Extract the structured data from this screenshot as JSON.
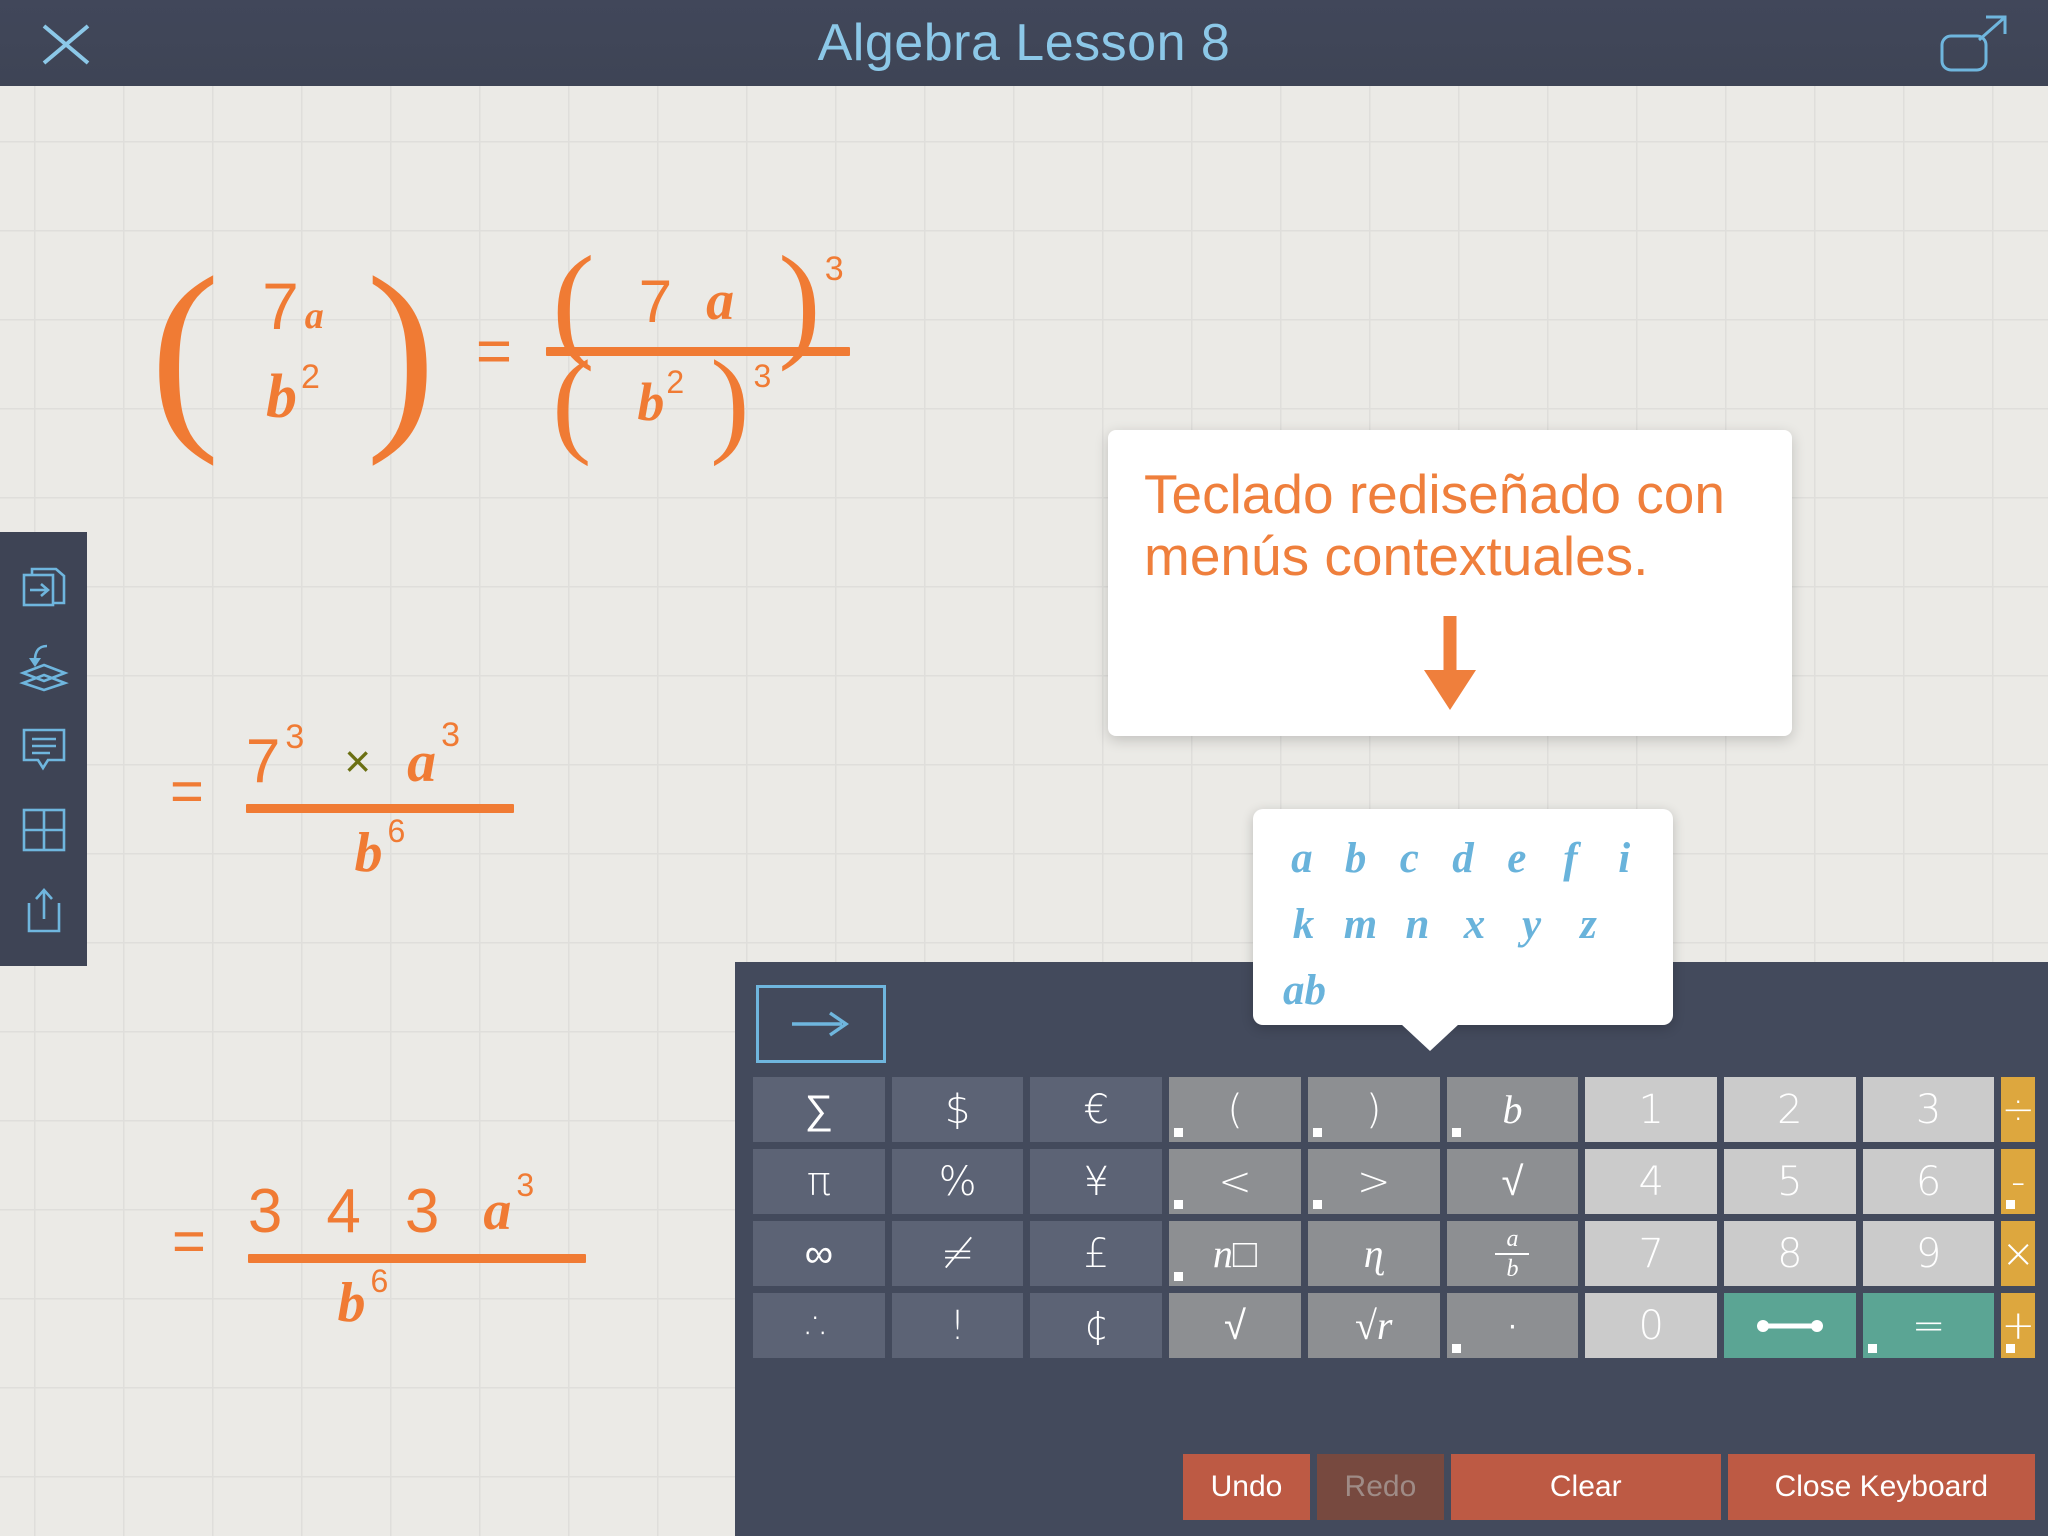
{
  "titlebar": {
    "title": "Algebra Lesson 8",
    "close_label": "close",
    "expand_label": "expand",
    "accent": "#8cc8e8",
    "background": "#3e4455"
  },
  "toolrail": {
    "items": [
      {
        "name": "duplicate-page-icon",
        "label": "Duplicate page"
      },
      {
        "name": "insert-layer-icon",
        "label": "Insert layer"
      },
      {
        "name": "note-icon",
        "label": "Note"
      },
      {
        "name": "grid-icon",
        "label": "Grid"
      },
      {
        "name": "share-icon",
        "label": "Share"
      }
    ]
  },
  "canvas": {
    "background": "#ebeae6",
    "gridline": "#dfdedb",
    "ink": "#f07b34",
    "cross_color": "#6b7013",
    "equations": [
      {
        "id": "eq1",
        "latex": "( 7a / b^2 ) = (7 a)^3 / (b^2)^3",
        "left_open_paren": "(",
        "left_numerator": "7",
        "left_numerator_var": "a",
        "left_denominator_var": "b",
        "left_denominator_exp": "2",
        "left_close_paren": ")",
        "equals": "=",
        "right_num_open": "(",
        "right_num_seven": "7",
        "right_num_var": "a",
        "right_num_close": ")",
        "right_num_exp": "3",
        "right_den_open": "(",
        "right_den_var": "b",
        "right_den_var_exp": "2",
        "right_den_close": ")",
        "right_den_exp": "3"
      },
      {
        "id": "eq2",
        "latex": "= 7^3 \\times a^3 / b^6",
        "equals": "=",
        "num_seven": "7",
        "num_seven_exp": "3",
        "times": "×",
        "num_var": "a",
        "num_var_exp": "3",
        "den_var": "b",
        "den_var_exp": "6"
      },
      {
        "id": "eq3",
        "latex": "= 343 a^3 / b^6",
        "equals": "=",
        "digit1": "3",
        "digit2": "4",
        "digit3": "3",
        "num_var": "a",
        "num_var_exp": "3",
        "den_var": "b",
        "den_var_exp": "6"
      }
    ]
  },
  "callout": {
    "line1": "Teclado rediseñado con",
    "line2": "menús contextuales.",
    "arrow": "down-arrow-icon",
    "text_color": "#ef7f3c",
    "background": "#ffffff"
  },
  "variable_popup": {
    "text_color": "#69b3db",
    "rows": [
      [
        "a",
        "b",
        "c",
        "d",
        "e",
        "f",
        "i"
      ],
      [
        "k",
        "m",
        "n",
        "x",
        "y",
        "z"
      ],
      [
        "ab"
      ]
    ]
  },
  "keyboard": {
    "background": "#434a5c",
    "nav_key": "→",
    "rows": [
      [
        {
          "label": "∑",
          "style": "sym",
          "menu": false
        },
        {
          "label": "$",
          "style": "sym",
          "menu": false
        },
        {
          "label": "€",
          "style": "sym",
          "menu": false
        },
        {
          "label": "(",
          "style": "op",
          "menu": true
        },
        {
          "label": ")",
          "style": "op",
          "menu": true
        },
        {
          "label": "b",
          "style": "op",
          "menu": true,
          "italic": true
        },
        {
          "label": "1",
          "style": "digit",
          "menu": false
        },
        {
          "label": "2",
          "style": "digit",
          "menu": false
        },
        {
          "label": "3",
          "style": "digit",
          "menu": false
        },
        {
          "label": "÷",
          "style": "gold",
          "menu": false
        }
      ],
      [
        {
          "label": "π",
          "style": "sym",
          "menu": false
        },
        {
          "label": "%",
          "style": "sym",
          "menu": false
        },
        {
          "label": "¥",
          "style": "sym",
          "menu": false
        },
        {
          "label": "<",
          "style": "op",
          "menu": true
        },
        {
          "label": ">",
          "style": "op",
          "menu": true
        },
        {
          "label": "√",
          "style": "op",
          "menu": false
        },
        {
          "label": "4",
          "style": "digit",
          "menu": false
        },
        {
          "label": "5",
          "style": "digit",
          "menu": false
        },
        {
          "label": "6",
          "style": "digit",
          "menu": false
        },
        {
          "label": "-",
          "style": "gold",
          "menu": true
        }
      ],
      [
        {
          "label": "∞",
          "style": "sym",
          "menu": false
        },
        {
          "label": "≠",
          "style": "sym",
          "menu": false
        },
        {
          "label": "£",
          "style": "sym",
          "menu": false
        },
        {
          "label": "n□",
          "style": "op",
          "menu": true,
          "italic": true
        },
        {
          "label": "ɳ",
          "style": "op",
          "menu": false,
          "italic": true
        },
        {
          "label": "a/b",
          "style": "op",
          "menu": false,
          "fraction": true
        },
        {
          "label": "7",
          "style": "digit",
          "menu": false
        },
        {
          "label": "8",
          "style": "digit",
          "menu": false
        },
        {
          "label": "9",
          "style": "digit",
          "menu": false
        },
        {
          "label": "×",
          "style": "gold",
          "menu": false
        }
      ],
      [
        {
          "label": "∴",
          "style": "sym",
          "menu": false
        },
        {
          "label": "!",
          "style": "sym",
          "menu": false
        },
        {
          "label": "¢",
          "style": "sym",
          "menu": false
        },
        {
          "label": "√",
          "style": "op",
          "menu": false
        },
        {
          "label": "√r",
          "style": "op",
          "menu": false
        },
        {
          "label": "·",
          "style": "op",
          "menu": true
        },
        {
          "label": "0",
          "style": "digit",
          "menu": false
        },
        {
          "label": "—",
          "style": "teal",
          "menu": false
        },
        {
          "label": "=",
          "style": "teal",
          "menu": true
        },
        {
          "label": "+",
          "style": "gold",
          "menu": true
        }
      ]
    ],
    "actions": {
      "undo": "Undo",
      "redo": "Redo",
      "clear": "Clear",
      "close": "Close Keyboard",
      "redo_disabled": true,
      "action_color": "#bd5a44",
      "disabled_color": "#77493f"
    }
  }
}
